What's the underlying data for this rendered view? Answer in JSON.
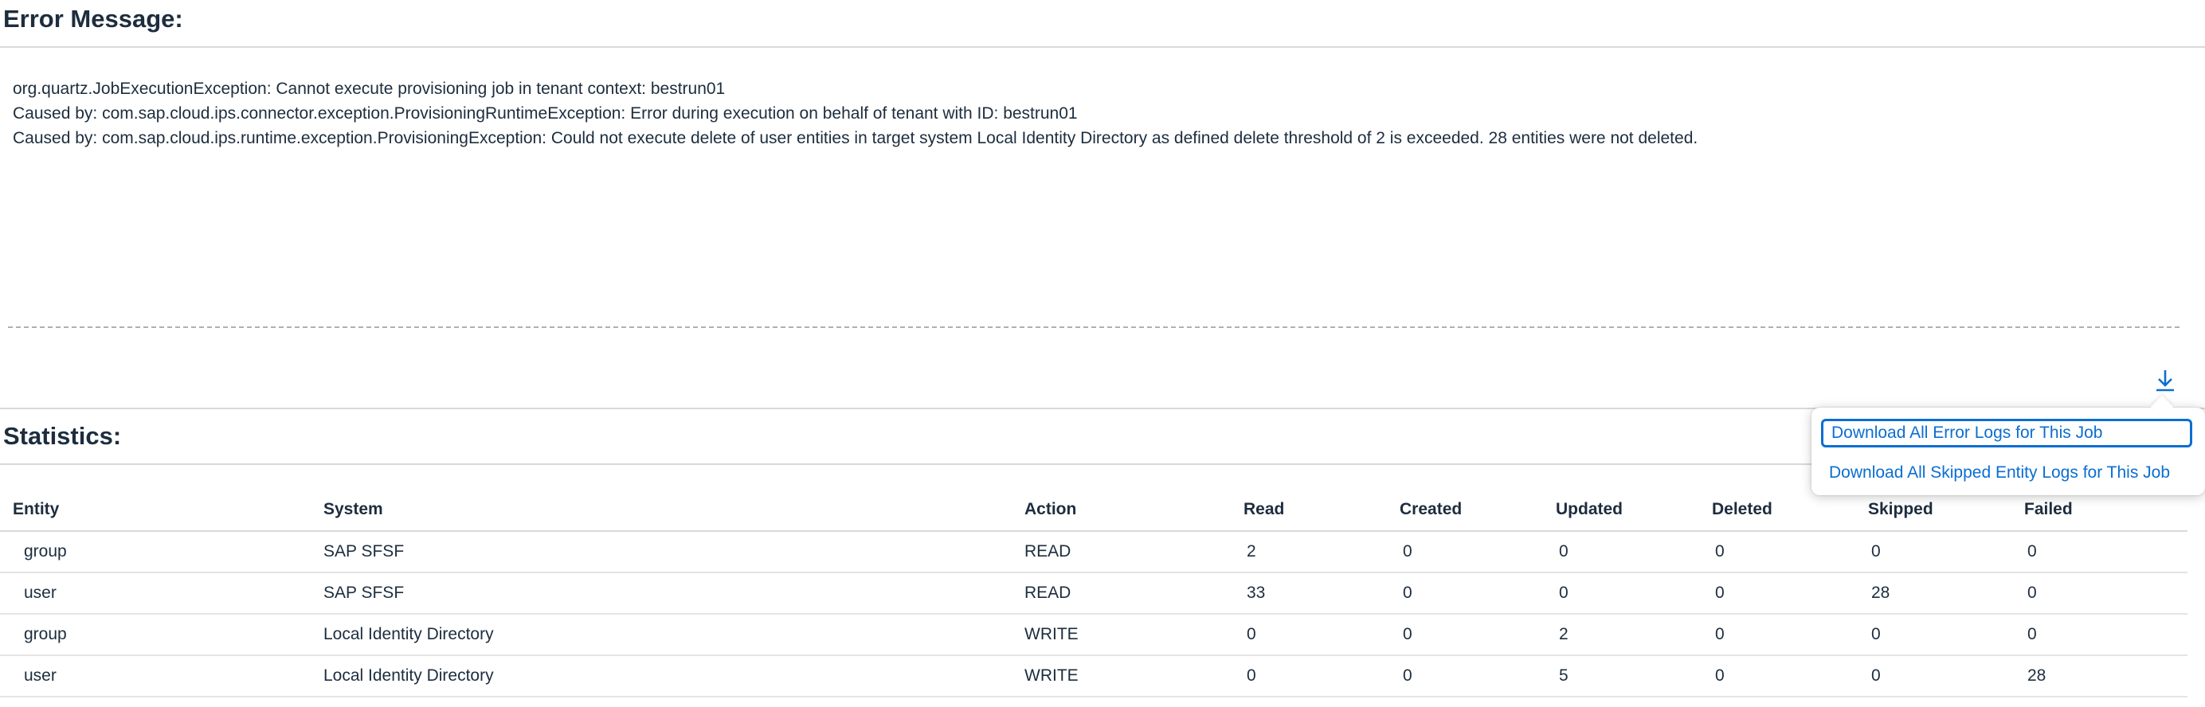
{
  "error_section": {
    "title": "Error Message:",
    "lines": [
      "org.quartz.JobExecutionException: Cannot execute provisioning job in tenant context: bestrun01",
      "Caused by: com.sap.cloud.ips.connector.exception.ProvisioningRuntimeException: Error during execution on behalf of tenant with ID: bestrun01",
      "Caused by: com.sap.cloud.ips.runtime.exception.ProvisioningException: Could not execute delete of user entities in target system Local Identity Directory as defined delete threshold of 2 is exceeded. 28 entities were not deleted."
    ]
  },
  "toolbar": {
    "download_icon": "download-icon"
  },
  "download_menu": {
    "items": [
      "Download All Error Logs for This Job",
      "Download All Skipped Entity Logs for This Job"
    ]
  },
  "stats_section": {
    "title": "Statistics:",
    "columns": [
      "Entity",
      "System",
      "Action",
      "Read",
      "Created",
      "Updated",
      "Deleted",
      "Skipped",
      "Failed"
    ],
    "rows": [
      [
        "group",
        "SAP SFSF",
        "READ",
        "2",
        "0",
        "0",
        "0",
        "0",
        "0"
      ],
      [
        "user",
        "SAP SFSF",
        "READ",
        "33",
        "0",
        "0",
        "0",
        "28",
        "0"
      ],
      [
        "group",
        "Local Identity Directory",
        "WRITE",
        "0",
        "0",
        "2",
        "0",
        "0",
        "0"
      ],
      [
        "user",
        "Local Identity Directory",
        "WRITE",
        "0",
        "0",
        "5",
        "0",
        "0",
        "28"
      ]
    ]
  },
  "colors": {
    "text": "#1d2d3e",
    "link": "#0a6ed1",
    "border": "#d9d9d9"
  }
}
